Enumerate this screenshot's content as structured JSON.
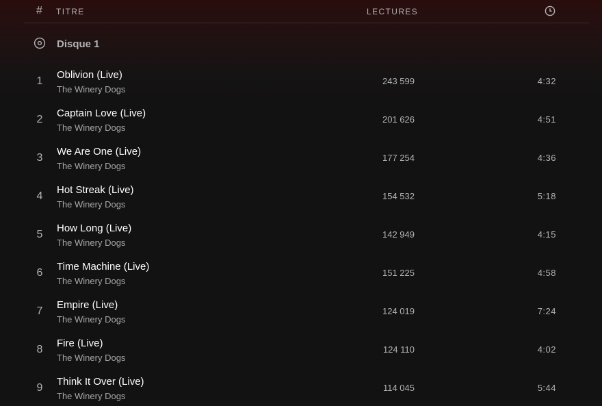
{
  "header": {
    "num_label": "#",
    "title_label": "TITRE",
    "plays_label": "LECTURES",
    "duration_icon": "clock-icon"
  },
  "disc": {
    "icon": "disc-icon",
    "label": "Disque 1"
  },
  "tracks": [
    {
      "num": "1",
      "title": "Oblivion (Live)",
      "artist": "The Winery Dogs",
      "plays": "243 599",
      "duration": "4:32"
    },
    {
      "num": "2",
      "title": "Captain Love (Live)",
      "artist": "The Winery Dogs",
      "plays": "201 626",
      "duration": "4:51"
    },
    {
      "num": "3",
      "title": "We Are One (Live)",
      "artist": "The Winery Dogs",
      "plays": "177 254",
      "duration": "4:36"
    },
    {
      "num": "4",
      "title": "Hot Streak (Live)",
      "artist": "The Winery Dogs",
      "plays": "154 532",
      "duration": "5:18"
    },
    {
      "num": "5",
      "title": "How Long (Live)",
      "artist": "The Winery Dogs",
      "plays": "142 949",
      "duration": "4:15"
    },
    {
      "num": "6",
      "title": "Time Machine (Live)",
      "artist": "The Winery Dogs",
      "plays": "151 225",
      "duration": "4:58"
    },
    {
      "num": "7",
      "title": "Empire (Live)",
      "artist": "The Winery Dogs",
      "plays": "124 019",
      "duration": "7:24"
    },
    {
      "num": "8",
      "title": "Fire (Live)",
      "artist": "The Winery Dogs",
      "plays": "124 110",
      "duration": "4:02"
    },
    {
      "num": "9",
      "title": "Think It Over (Live)",
      "artist": "The Winery Dogs",
      "plays": "114 045",
      "duration": "5:44"
    }
  ]
}
